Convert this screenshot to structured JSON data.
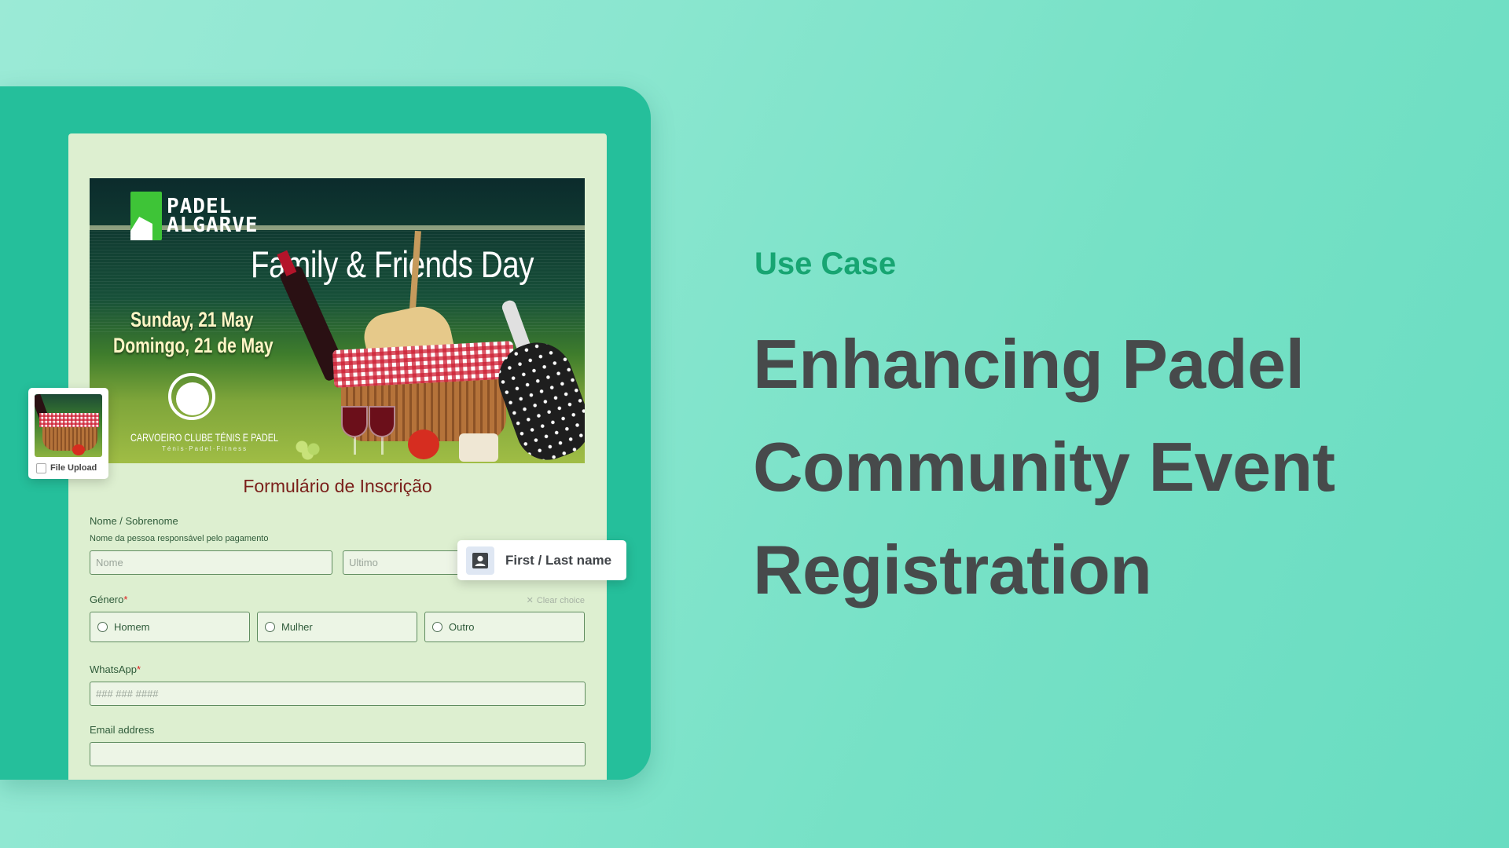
{
  "banner": {
    "brand_line1": "PADEL",
    "brand_line2": "ALGARVE",
    "event_title": "Family & Friends Day",
    "date_en": "Sunday, 21 May",
    "date_pt": "Domingo, 21 de May",
    "club_name": "CARVOEIRO CLUBE TÉNIS E PADEL",
    "club_tagline": "Ténis·Padel·Fitness"
  },
  "file_upload": {
    "label": "File Upload",
    "checked": false
  },
  "form": {
    "title": "Formulário de Inscrição",
    "name_field": {
      "label": "Nome / Sobrenome",
      "helper": "Nome da pessoa responsável pelo pagamento",
      "first_placeholder": "Nome",
      "last_placeholder": "Ultimo"
    },
    "gender_field": {
      "label": "Género",
      "required_mark": "*",
      "clear_label": "Clear choice",
      "options": [
        "Homem",
        "Mulher",
        "Outro"
      ]
    },
    "whatsapp_field": {
      "label": "WhatsApp",
      "required_mark": "*",
      "placeholder": "### ### ####"
    },
    "email_field": {
      "label": "Email address",
      "value": ""
    }
  },
  "tooltip": {
    "icon": "contact-card-icon",
    "label": "First / Last name"
  },
  "hero": {
    "eyebrow": "Use Case",
    "headline_lines": [
      "Enhancing Padel",
      "Community Event",
      "Registration"
    ]
  },
  "colors": {
    "eyebrow": "#17a572",
    "headline": "#474a4b",
    "panel": "#25bf9b",
    "form_bg": "#ddefd0",
    "form_title": "#7a1f1a"
  }
}
